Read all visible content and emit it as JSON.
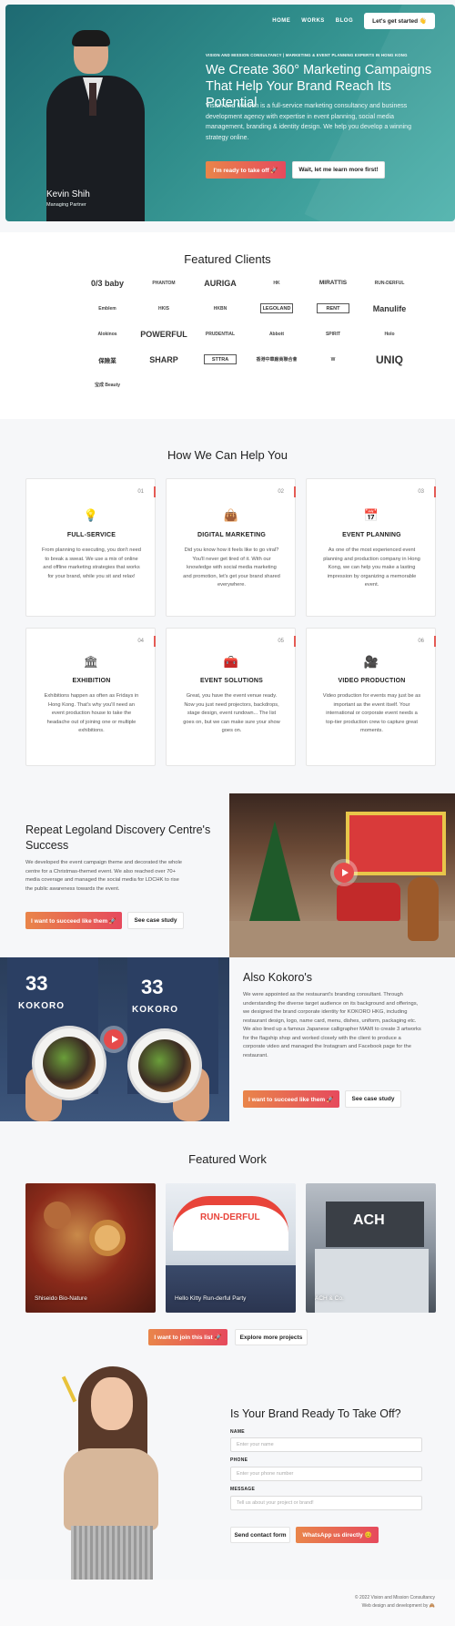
{
  "nav": {
    "links": [
      "HOME",
      "WORKS",
      "BLOG"
    ],
    "cta": "Let's get started 👋"
  },
  "hero": {
    "name": "Kevin Shih",
    "role": "Managing Partner",
    "kicker": "VISION AND MISSION CONSULTANCY | MARKETING & EVENT PLANNING EXPERTS IN HONG KONG",
    "title": "We Create 360° Marketing Campaigns That Help Your Brand Reach Its Potential",
    "description": "Vision and Mission is a full-service marketing consultancy and business development agency with expertise in event planning, social media management, branding & identity design. We help you develop a winning strategy online.",
    "primary_button": "I'm ready to take off 🚀",
    "secondary_button": "Wait, let me learn more first!"
  },
  "clients": {
    "title": "Featured Clients",
    "logos": [
      "0/3 baby",
      "PHANTOM",
      "AURIGA",
      "HK",
      "MIRATTIS",
      "RUN-DERFUL",
      "Emblem",
      "HKIS",
      "HKBN",
      "LEGOLAND",
      "RENT",
      "Manulife",
      "Alokinos",
      "POWERFUL",
      "PRUDENTIAL",
      "Abbott",
      "SPIRIT",
      "Holo",
      "保險業",
      "SHARP",
      "STTRA",
      "香港中華廠商聯合會",
      "W",
      "UNIQ",
      "宝成 Beauty"
    ]
  },
  "services": {
    "title": "How We Can Help You",
    "items": [
      {
        "num": "01",
        "icon": "💡",
        "title": "FULL-SERVICE",
        "desc": "From planning to executing, you don't need to break a sweat. We use a mix of online and offline marketing strategies that works for your brand, while you sit and relax!"
      },
      {
        "num": "02",
        "icon": "👜",
        "title": "DIGITAL MARKETING",
        "desc": "Did you know how it feels like to go viral? You'll never get tired of it. With our knowledge with social media marketing and promotion, let's get your brand shared everywhere."
      },
      {
        "num": "03",
        "icon": "📅",
        "title": "EVENT PLANNING",
        "desc": "As one of the most experienced event planning and production company in Hong Kong, we can help you make a lasting impression by organizing a memorable event."
      },
      {
        "num": "04",
        "icon": "🏛",
        "title": "EXHIBITION",
        "desc": "Exhibitions happen as often as Fridays in Hong Kong. That's why you'll need an event production house to take the headache out of joining one or multiple exhibitions."
      },
      {
        "num": "05",
        "icon": "🧰",
        "title": "EVENT SOLUTIONS",
        "desc": "Great, you have the event venue ready. Now you just need projectors, backdrops, stage design, event rundown... The list goes on, but we can make sure your show goes on."
      },
      {
        "num": "06",
        "icon": "🎥",
        "title": "VIDEO PRODUCTION",
        "desc": "Video production for events may just be as important as the event itself. Your international or corporate event needs a top-tier production crew to capture great moments."
      }
    ]
  },
  "case1": {
    "title": "Repeat Legoland Discovery Centre's Success",
    "desc": "We developed the event campaign theme and decorated the whole centre for a Christmas-themed event. We also reached over 70+ media coverage and managed the social media for LDCHK to rise the public awareness towards the event.",
    "primary": "I want to succeed like them 🚀",
    "secondary": "See case study"
  },
  "case2": {
    "title": "Also Kokoro's",
    "desc": "We were appointed as the restaurant's branding consultant. Through understanding the diverse target audience on its background and offerings, we designed the brand corporate identity for KOKORO HKG, including restaurant design, logo, name card, menu, dishes, uniform, packaging etc. We also lined up a famous Japanese calligrapher MAMI to create 3 artworks for the flagship shop and worked closely with the client to produce a corporate video and managed the Instagram and Facebook page for the restaurant.",
    "primary": "I want to succeed like them 🚀",
    "secondary": "See case study"
  },
  "works": {
    "title": "Featured Work",
    "items": [
      "Shiseido Bio-Nature",
      "Hello Kitty Run-derful Party",
      "ACH & Co."
    ],
    "primary": "I want to join this list 🚀",
    "secondary": "Explore more projects"
  },
  "contact": {
    "title": "Is Your Brand Ready To Take Off?",
    "name_label": "NAME",
    "name_placeholder": "Enter your name",
    "phone_label": "PHONE",
    "phone_placeholder": "Enter your phone number",
    "message_label": "MESSAGE",
    "message_placeholder": "Tell us about your project or brand!",
    "send": "Send contact form",
    "whatsapp": "WhatsApp us directly 😊"
  },
  "footer": {
    "copyright": "© 2022 Vision and Mission Consultancy",
    "credit": "Web design and development by 🙈"
  },
  "colors": {
    "accent_start": "#e9854a",
    "accent_end": "#e64a5d",
    "hero_teal": "#2f8c8a"
  }
}
